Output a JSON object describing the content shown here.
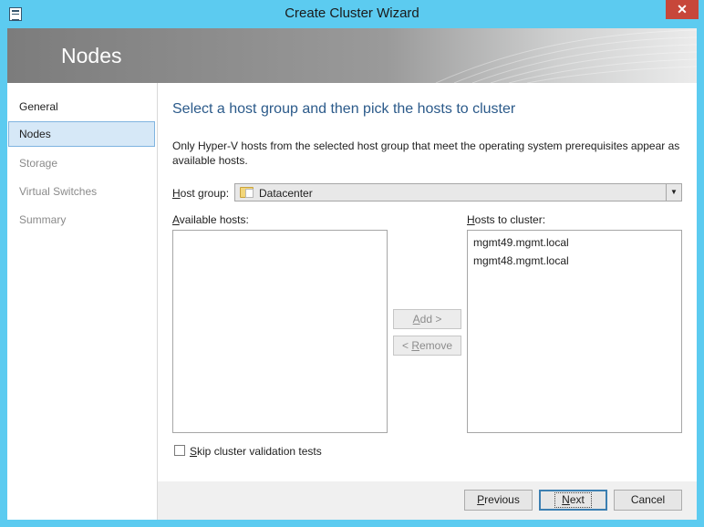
{
  "window": {
    "title": "Create Cluster Wizard",
    "close_glyph": "✕"
  },
  "header": {
    "title": "Nodes"
  },
  "sidebar": {
    "items": [
      {
        "label": "General",
        "state": "normal"
      },
      {
        "label": "Nodes",
        "state": "active"
      },
      {
        "label": "Storage",
        "state": "disabled"
      },
      {
        "label": "Virtual Switches",
        "state": "disabled"
      },
      {
        "label": "Summary",
        "state": "disabled"
      }
    ]
  },
  "main": {
    "heading": "Select a host group and then pick the hosts to cluster",
    "description": "Only Hyper-V hosts from the selected host group that meet the operating system prerequisites appear as available hosts.",
    "host_group": {
      "label_hotkey": "H",
      "label_rest": "ost group:",
      "value": "Datacenter"
    },
    "available_hosts": {
      "label_hotkey": "A",
      "label_rest": "vailable hosts:",
      "items": []
    },
    "hosts_to_cluster": {
      "label_hotkey": "H",
      "label_rest": "osts to cluster:",
      "items": [
        "mgmt49.mgmt.local",
        "mgmt48.mgmt.local"
      ]
    },
    "add_button": {
      "hotkey": "A",
      "rest": "dd >"
    },
    "remove_button": {
      "prefix": "< ",
      "hotkey": "R",
      "rest": "emove"
    },
    "skip_validation": {
      "hotkey": "S",
      "rest": "kip cluster validation tests",
      "checked": false
    }
  },
  "footer": {
    "previous": {
      "hotkey": "P",
      "rest": "revious"
    },
    "next": {
      "hotkey": "N",
      "rest": "ext"
    },
    "cancel": "Cancel"
  }
}
